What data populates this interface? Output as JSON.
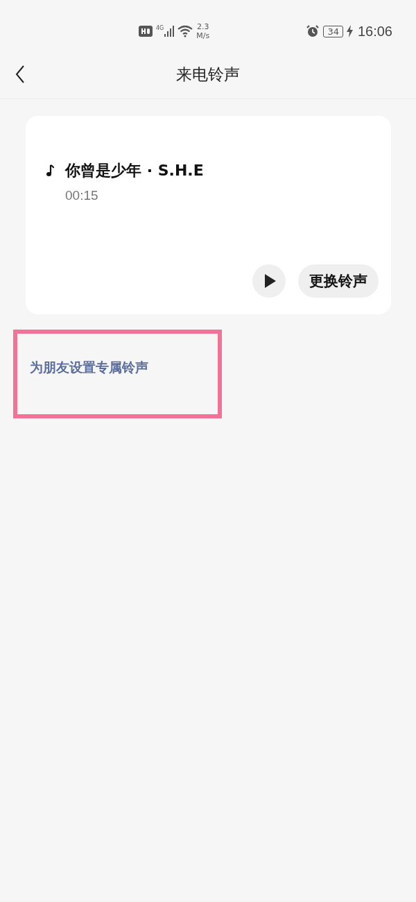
{
  "status_bar": {
    "network": "4G",
    "speed_value": "2.3",
    "speed_unit": "M/s",
    "battery": "34",
    "charging": true,
    "time": "16:06"
  },
  "header": {
    "title": "来电铃声"
  },
  "ringtone": {
    "name": "你曾是少年 · S.H.E",
    "duration": "00:15",
    "change_label": "更换铃声"
  },
  "friend_ringtone": {
    "label": "为朋友设置专属铃声",
    "highlighted": true
  }
}
